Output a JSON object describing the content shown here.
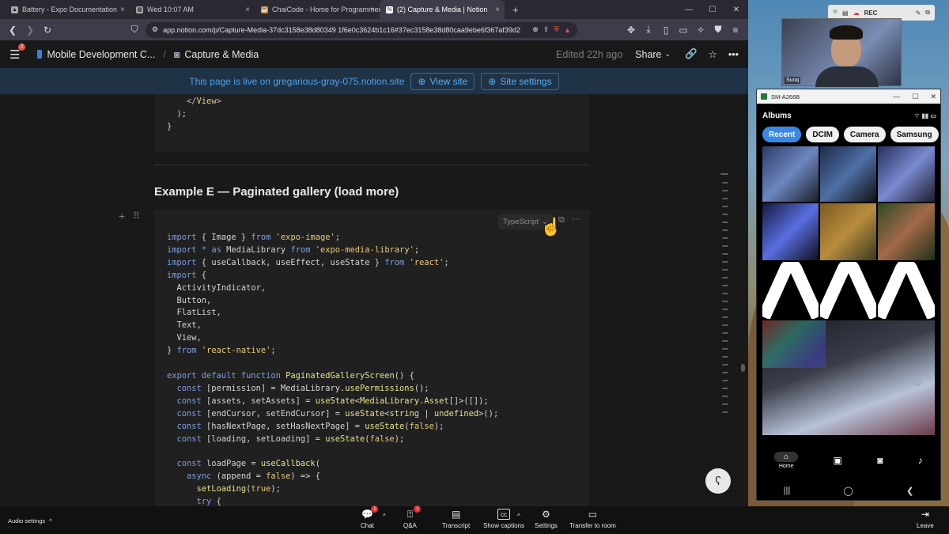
{
  "browser": {
    "tabs": [
      {
        "label": "Battery - Expo Documentation",
        "icon": "expo-icon"
      },
      {
        "label": "Wed 10:07 AM",
        "icon": "calendar-icon"
      },
      {
        "label": "ChaiCode - Home for Programmers",
        "icon": "chai-icon"
      },
      {
        "label": "(2) Capture & Media | Notion",
        "icon": "notion-icon",
        "active": true
      }
    ],
    "url": "app.notion.com/p/Capture-Media-37dc3158e38d80349 1f6e0c3624b1c16#37ec3158e38d80caa9ebe6f367af39d2"
  },
  "notion": {
    "breadcrumb_parent": "Mobile Development C...",
    "breadcrumb_page": "Capture & Media",
    "edited": "Edited 22h ago",
    "share_label": "Share",
    "notification_count": "2",
    "live_text": "This page is live on gregarious-gray-075.notion.site",
    "view_site": "View site",
    "site_settings": "Site settings",
    "heading": "Example E — Paginated gallery (load more)",
    "code_language": "TypeScript"
  },
  "taskbar": {
    "audio_settings": "Audio settings",
    "chat": "Chat",
    "chat_badge": "1",
    "qa": "Q&A",
    "qa_badge": "1",
    "transcript": "Transcript",
    "show_captions": "Show captions",
    "settings": "Settings",
    "transfer": "Transfer to room",
    "leave": "Leave"
  },
  "webcam": {
    "name": "Suraj"
  },
  "recorder": {
    "label": "REC"
  },
  "phone": {
    "window_title": "SM-A266B",
    "app_title": "Albums",
    "chips": [
      "Recent",
      "DCIM",
      "Camera",
      "Samsung"
    ],
    "nav_home": "Home"
  }
}
